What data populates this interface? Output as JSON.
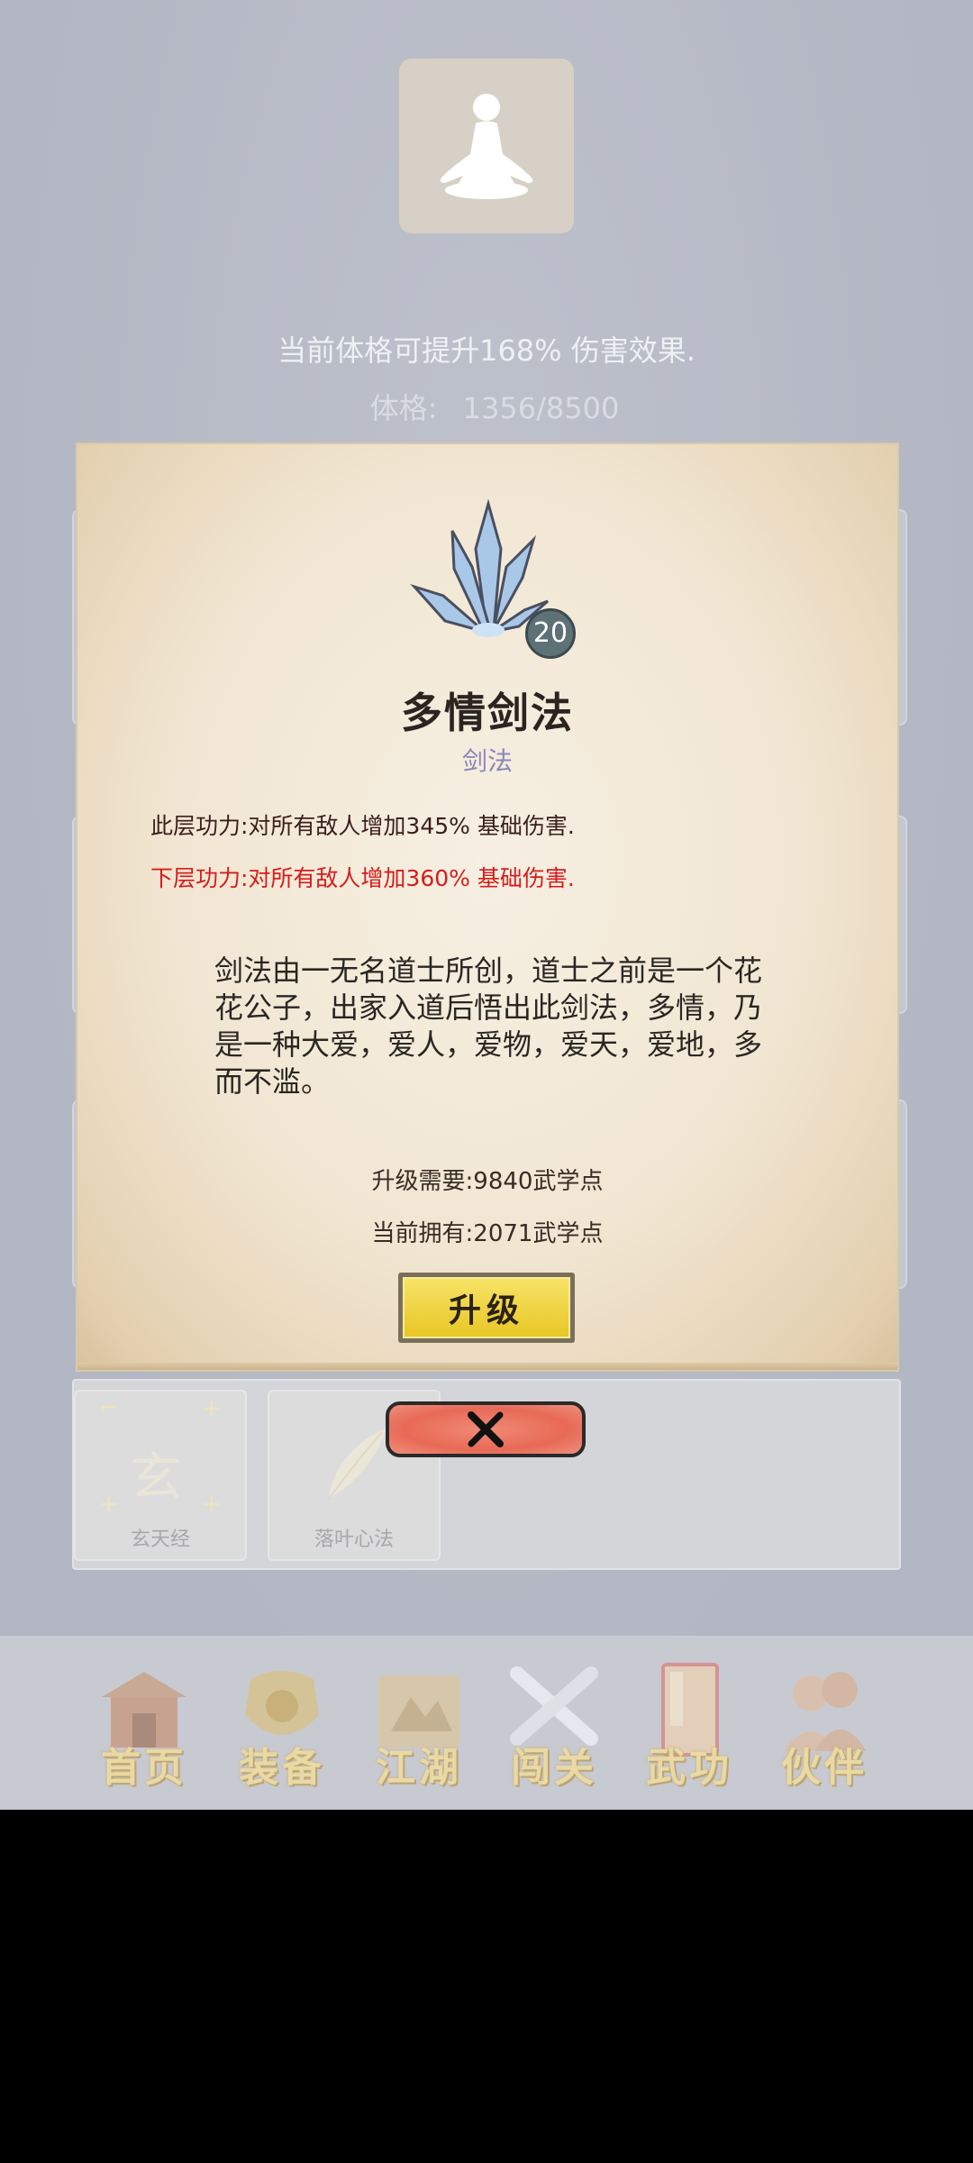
{
  "header": {
    "hint_text": "当前体格可提升168% 伤害效果.",
    "stat_label": "体格:",
    "stat_value": "1356/8500"
  },
  "skill_modal": {
    "level": "20",
    "name": "多情剑法",
    "type": "剑法",
    "current_effect": "此层功力:对所有敌人增加345% 基础伤害.",
    "next_effect": "下层功力:对所有敌人增加360% 基础伤害.",
    "description": "剑法由一无名道士所创，道士之前是一个花花公子，出家入道后悟出此剑法，多情，乃是一种大爱，爱人，爱物，爱天，爱地，多而不滥。",
    "upgrade_cost": "升级需要:9840武学点",
    "current_points": "当前拥有:2071武学点",
    "upgrade_label": "升级",
    "colors": {
      "next_effect": "#d61c1c",
      "type": "#8a87b8",
      "upgrade_button": "#e8c626",
      "close_button": "#e86a56"
    }
  },
  "skill_list": {
    "items": [
      {
        "label": "玄天经",
        "glyph": "玄"
      },
      {
        "label": "落叶心法",
        "icon": "leaf-icon"
      }
    ]
  },
  "bottom_nav": {
    "items": [
      {
        "label": "首页",
        "icon": "house-icon"
      },
      {
        "label": "装备",
        "icon": "armor-icon"
      },
      {
        "label": "江湖",
        "icon": "scroll-map-icon"
      },
      {
        "label": "闯关",
        "icon": "crossed-swords-icon"
      },
      {
        "label": "武功",
        "icon": "book-icon"
      },
      {
        "label": "伙伴",
        "icon": "companions-icon"
      }
    ]
  }
}
